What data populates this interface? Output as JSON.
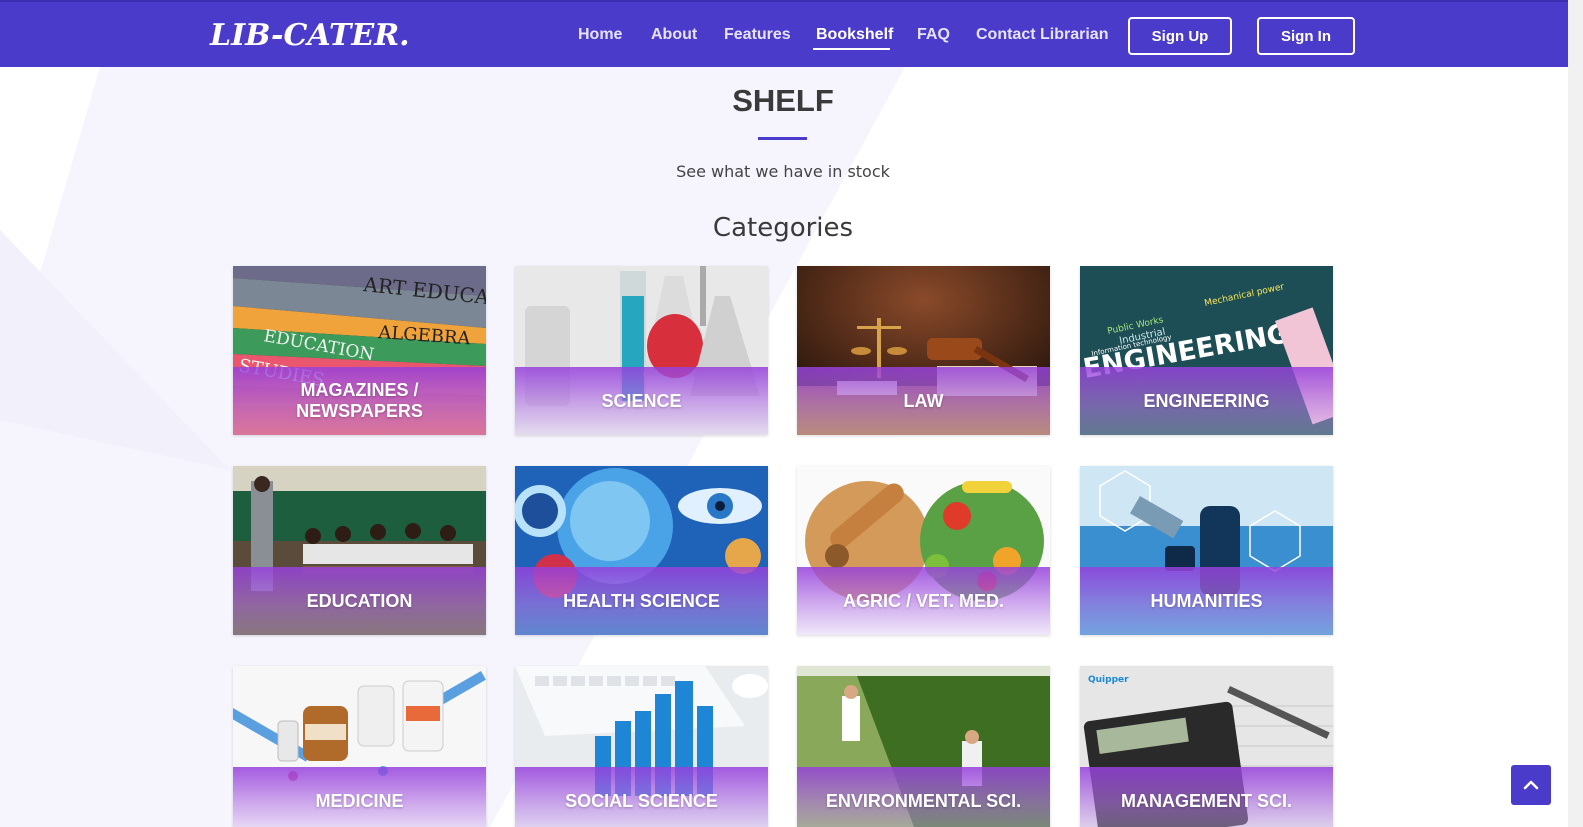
{
  "brand": {
    "logo_text": "LIB-CATER.",
    "accent_color": "#4b3bcb"
  },
  "nav": {
    "links": [
      {
        "label": "Home"
      },
      {
        "label": "About"
      },
      {
        "label": "Features"
      },
      {
        "label": "Bookshelf",
        "active": true
      },
      {
        "label": "FAQ"
      },
      {
        "label": "Contact Librarian"
      }
    ],
    "signup_label": "Sign Up",
    "signin_label": "Sign In"
  },
  "section": {
    "title": "SHELF",
    "subtitle": "See what we have in stock",
    "categories_heading": "Categories"
  },
  "categories": [
    {
      "label": "MAGAZINES / NEWSPAPERS",
      "image": "books-stack-image"
    },
    {
      "label": "SCIENCE",
      "image": "lab-glassware-image"
    },
    {
      "label": "LAW",
      "image": "gavel-scales-image"
    },
    {
      "label": "ENGINEERING",
      "image": "engineering-word-cloud-image"
    },
    {
      "label": "EDUCATION",
      "image": "classroom-image"
    },
    {
      "label": "HEALTH SCIENCE",
      "image": "cells-eye-image"
    },
    {
      "label": "AGRIC / VET. MED.",
      "image": "food-produce-image"
    },
    {
      "label": "HUMANITIES",
      "image": "microscope-image"
    },
    {
      "label": "MEDICINE",
      "image": "syringes-pills-image"
    },
    {
      "label": "SOCIAL SCIENCE",
      "image": "keyboard-bar-chart-image"
    },
    {
      "label": "ENVIRONMENTAL SCI.",
      "image": "field-researchers-image"
    },
    {
      "label": "MANAGEMENT SCI.",
      "image": "calculator-pen-image"
    }
  ],
  "icons": {
    "scroll_top": "chevron-up-icon"
  }
}
